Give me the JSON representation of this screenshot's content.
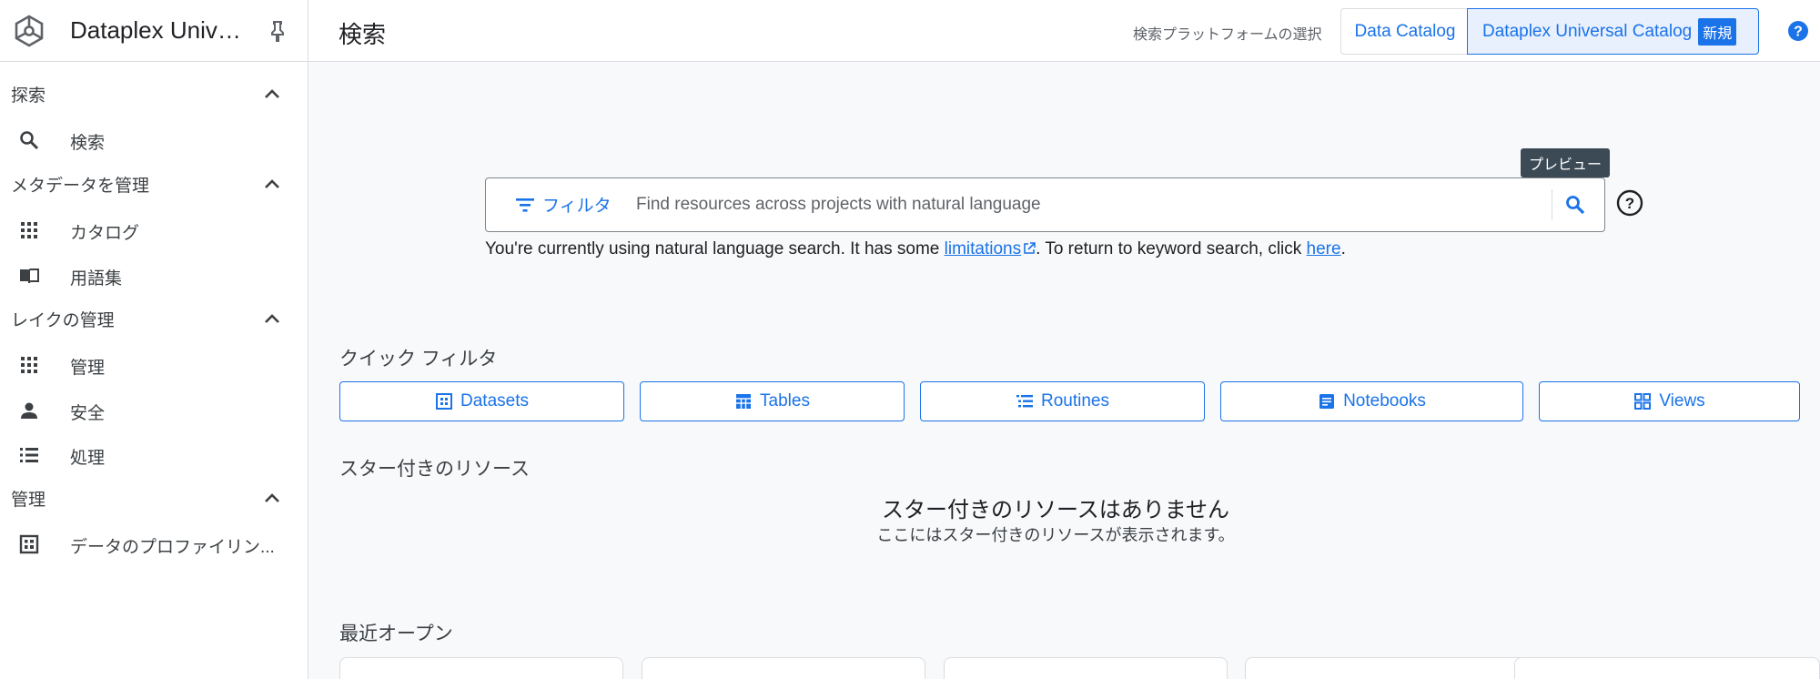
{
  "sidebar": {
    "brand_title": "Dataplex Univers...",
    "sections": [
      {
        "label": "探索",
        "items": [
          {
            "label": "検索",
            "icon": "search-icon"
          }
        ]
      },
      {
        "label": "メタデータを管理",
        "items": [
          {
            "label": "カタログ",
            "icon": "grid-icon"
          },
          {
            "label": "用語集",
            "icon": "book-icon"
          }
        ]
      },
      {
        "label": "レイクの管理",
        "items": [
          {
            "label": "管理",
            "icon": "grid-icon"
          },
          {
            "label": "安全",
            "icon": "person-icon"
          },
          {
            "label": "処理",
            "icon": "list-icon"
          }
        ]
      },
      {
        "label": "管理",
        "items": [
          {
            "label": "データのプロファイリン...",
            "icon": "profile-icon"
          }
        ]
      }
    ]
  },
  "header": {
    "title": "検索",
    "platform_label": "検索プラットフォームの選択",
    "platform_options": [
      "Data Catalog",
      "Dataplex Universal Catalog"
    ],
    "new_badge": "新規"
  },
  "search": {
    "tooltip": "プレビュー",
    "filter_label": "フィルタ",
    "placeholder": "Find resources across projects with natural language",
    "value": "",
    "note_before": "You're currently using natural language search. It has some ",
    "note_link1": "limitations",
    "note_middle": ". To return to keyword search, click ",
    "note_link2": "here",
    "note_after": "."
  },
  "quick_filters": {
    "title": "クイック フィルタ",
    "chips": [
      {
        "label": "Datasets",
        "icon": "dataset-icon"
      },
      {
        "label": "Tables",
        "icon": "table-icon"
      },
      {
        "label": "Routines",
        "icon": "routine-icon"
      },
      {
        "label": "Notebooks",
        "icon": "notebook-icon"
      },
      {
        "label": "Views",
        "icon": "views-icon"
      }
    ]
  },
  "starred": {
    "title": "スター付きのリソース",
    "empty_title": "スター付きのリソースはありません",
    "empty_subtitle": "ここにはスター付きのリソースが表示されます。"
  },
  "recent": {
    "title": "最近オープン"
  },
  "colors": {
    "accent": "#1a73e8",
    "selected_bg": "#e8f0fe",
    "tooltip_bg": "#3c4a56"
  }
}
